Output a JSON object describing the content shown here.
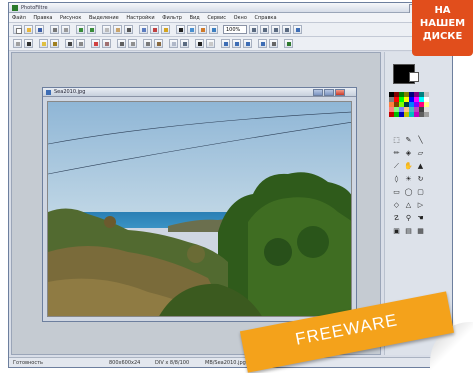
{
  "window": {
    "title": "PhotoFiltre",
    "buttons": [
      "_",
      "□",
      "×"
    ]
  },
  "menu": [
    "Файл",
    "Правка",
    "Рисунок",
    "Выделение",
    "Настройки",
    "Фильтр",
    "Вид",
    "Сервис",
    "Окно",
    "Справка"
  ],
  "toolbar": {
    "zoom_value": "100%"
  },
  "document": {
    "title": "Sea2010.jpg"
  },
  "status": {
    "left": "Готовность",
    "size": "800x600x24",
    "color": "DIV x 8/8/100",
    "file": "MB/Sea2010.jpg"
  },
  "badge": {
    "line1": "НА",
    "line2": "НАШЕМ",
    "line3": "ДИСКЕ"
  },
  "ribbon": {
    "text": "FREEWARE"
  },
  "colors": {
    "accent_badge": "#e14e1c",
    "ribbon": "#f4a21b",
    "sky": "#9ec1dd",
    "sea": "#2f86b8",
    "foliage": "#2e5a17"
  },
  "icons": {
    "app": "photofiltre-logo-icon",
    "image_doc": "image-file-icon",
    "tools": [
      "selection-icon",
      "eyedropper-icon",
      "line-icon",
      "pencil-icon",
      "fill-icon",
      "erase-icon",
      "brush-icon",
      "smudge-icon",
      "stamp-icon",
      "drop-icon",
      "blur-icon",
      "rotate-icon",
      "rectangle-icon",
      "ellipse-icon",
      "rounded-rect-icon",
      "diamond-icon",
      "triangle-icon",
      "polygon-icon",
      "lasso-icon",
      "magic-wand-icon",
      "hand-icon",
      "zoom-grid-icon",
      "frame-icon",
      "grid-icon"
    ]
  }
}
